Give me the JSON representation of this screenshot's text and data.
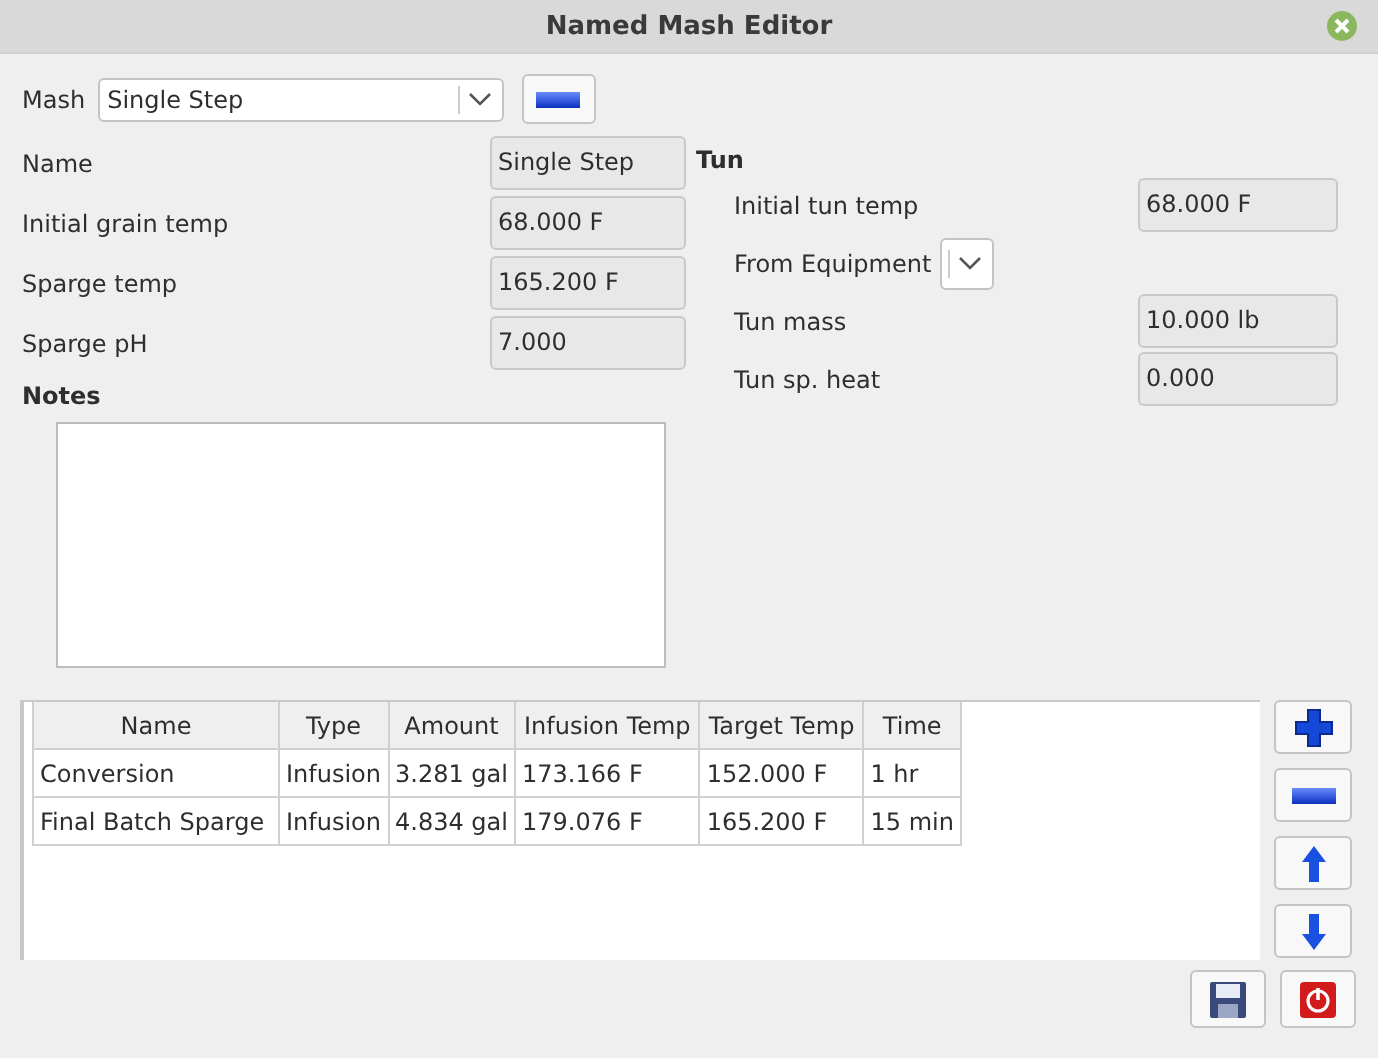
{
  "window": {
    "title": "Named Mash Editor"
  },
  "mash": {
    "label": "Mash",
    "value": "Single Step"
  },
  "fields": [
    {
      "label": "Name",
      "value": "Single Step"
    },
    {
      "label": "Initial grain temp",
      "value": "68.000 F"
    },
    {
      "label": "Sparge temp",
      "value": "165.200 F"
    },
    {
      "label": "Sparge pH",
      "value": "7.000"
    }
  ],
  "tun": {
    "heading": "Tun",
    "fields": [
      {
        "kind": "text",
        "label": "Initial tun temp",
        "value": "68.000 F"
      },
      {
        "kind": "combo",
        "label": "From Equipment"
      },
      {
        "kind": "text",
        "label": "Tun mass",
        "value": "10.000 lb"
      },
      {
        "kind": "text",
        "label": "Tun sp. heat",
        "value": "0.000"
      }
    ]
  },
  "notes": {
    "label": "Notes"
  },
  "table": {
    "columns": [
      "Name",
      "Type",
      "Amount",
      "Infusion Temp",
      "Target Temp",
      "Time"
    ],
    "rows": [
      [
        "Conversion",
        "Infusion",
        "3.281 gal",
        "173.166 F",
        "152.000 F",
        "1 hr"
      ],
      [
        "Final Batch Sparge",
        "Infusion",
        "4.834 gal",
        "179.076 F",
        "165.200 F",
        "15 min"
      ]
    ]
  }
}
